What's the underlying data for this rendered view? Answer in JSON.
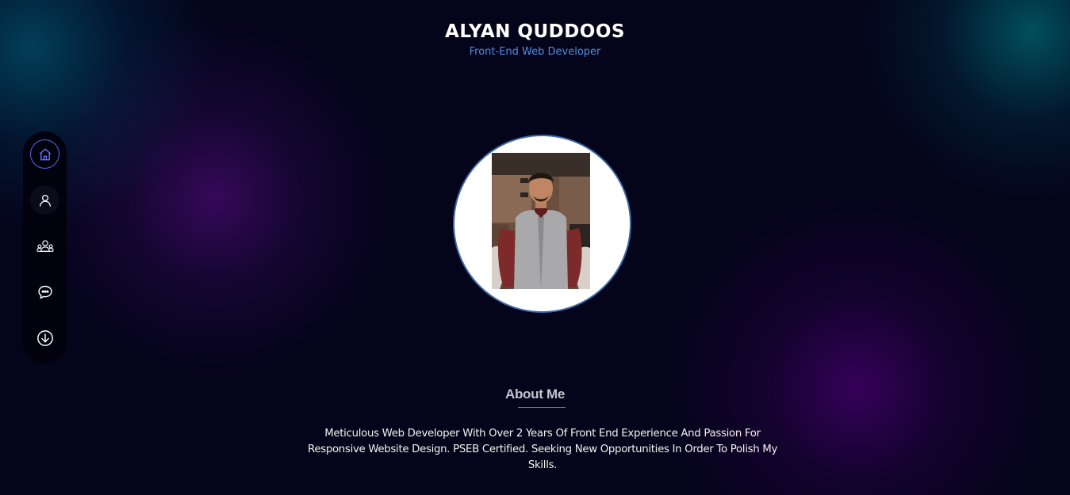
{
  "header": {
    "name": "ALYAN QUDDOOS",
    "subtitle": "Front-End Web Developer"
  },
  "sidebar": {
    "items": [
      {
        "icon": "home-icon",
        "label": "Home",
        "active": true
      },
      {
        "icon": "user-icon",
        "label": "About"
      },
      {
        "icon": "team-icon",
        "label": "Skills"
      },
      {
        "icon": "chat-icon",
        "label": "Contact"
      },
      {
        "icon": "download-icon",
        "label": "Download"
      }
    ]
  },
  "profile": {
    "photo_icon": "profile-photo"
  },
  "about": {
    "title": "About Me",
    "text": "Meticulous Web Developer With Over 2 Years Of Front End Experience And Passion For Responsive Website Design. PSEB Certified. Seeking New Opportunities In Order To Polish My Skills."
  },
  "colors": {
    "accent": "#4e8fe0",
    "active_ring": "#5564e6",
    "background": "#04041a"
  }
}
